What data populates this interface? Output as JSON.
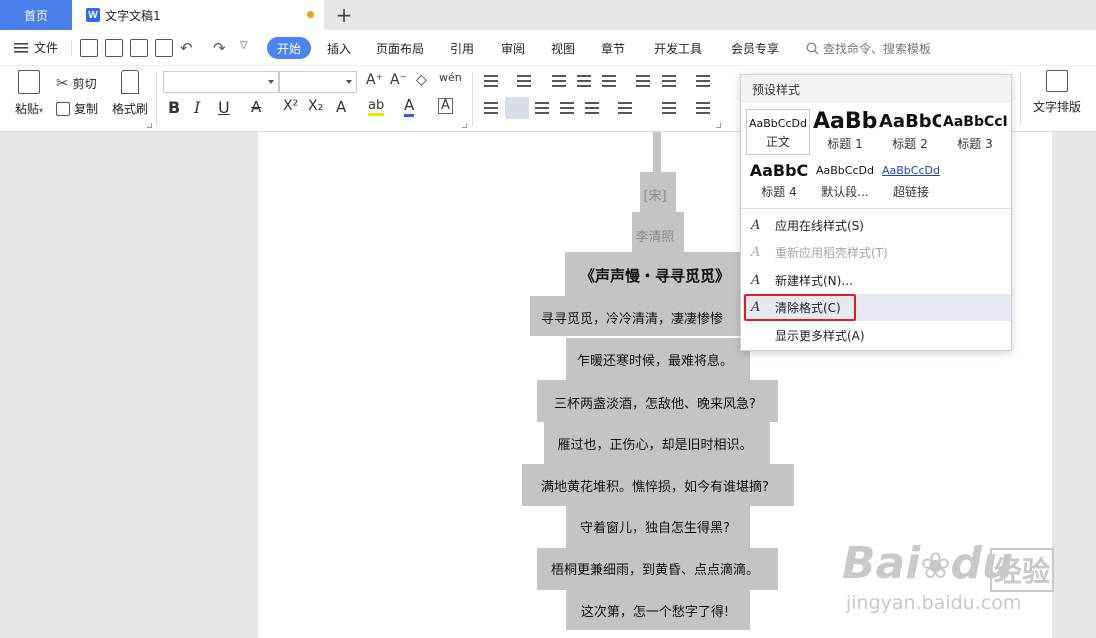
{
  "tabs": {
    "home": "首页",
    "document": "文字文稿1",
    "doc_icon": "W",
    "add": "+"
  },
  "menu": {
    "file": "文件",
    "items": [
      "开始",
      "插入",
      "页面布局",
      "引用",
      "审阅",
      "视图",
      "章节",
      "开发工具",
      "会员专享"
    ],
    "search_placeholder": "查找命令、搜索模板"
  },
  "ribbon": {
    "paste": "粘贴",
    "cut": "剪切",
    "copy": "复制",
    "format_painter": "格式刷",
    "text_layout": "文字排版",
    "glyphs": {
      "grow": "A⁺",
      "shrink": "A⁻",
      "eraser": "◇",
      "pinyin": "wén",
      "bold": "B",
      "italic": "I",
      "underline": "U",
      "strike": "A",
      "superscript": "X²",
      "subscript": "X₂",
      "text_effect": "A",
      "highlight": "ab",
      "font_color": "A",
      "char_border": "A"
    }
  },
  "style_panel": {
    "header": "预设样式",
    "styles": [
      {
        "sample": "AaBbCcDd",
        "name": "正文"
      },
      {
        "sample": "AaBb",
        "name": "标题 1"
      },
      {
        "sample": "AaBbC",
        "name": "标题 2"
      },
      {
        "sample": "AaBbCcI",
        "name": "标题 3"
      },
      {
        "sample": "AaBbC",
        "name": "标题 4"
      },
      {
        "sample": "AaBbCcDd",
        "name": "默认段..."
      },
      {
        "sample": "AaBbCcDd",
        "name": "超链接"
      }
    ],
    "actions": [
      {
        "label": "应用在线样式(S)",
        "enabled": true
      },
      {
        "label": "重新应用稻壳样式(T)",
        "enabled": false
      },
      {
        "label": "新建样式(N)...",
        "enabled": true
      },
      {
        "label": "清除格式(C)",
        "enabled": true
      },
      {
        "label": "显示更多样式(A)",
        "enabled": true
      }
    ]
  },
  "document": {
    "lines": [
      "[宋]",
      "李清照",
      "《声声慢・寻寻觅觅》",
      "寻寻觅觅，冷冷清清，凄凄惨惨",
      "乍暖还寒时候，最难将息。",
      "三杯两盏淡酒，怎敌他、晚来风急?",
      "雁过也，正伤心，却是旧时相识。",
      "满地黄花堆积。憔悴损，如今有谁堪摘?",
      "守着窗儿，独自怎生得黑?",
      "梧桐更兼细雨，到黄昏、点点滴滴。",
      "这次第，怎一个愁字了得!"
    ]
  },
  "watermark": {
    "brand": "Bai",
    "brand2": "du",
    "cn": "经验",
    "url": "jingyan.baidu.com"
  },
  "colors": {
    "accent": "#4a84f0",
    "tab_home": "#4a7ee8",
    "selection": "#c4c4c4",
    "highlight_box": "#e02020",
    "unsaved_dot": "#f0a020"
  }
}
